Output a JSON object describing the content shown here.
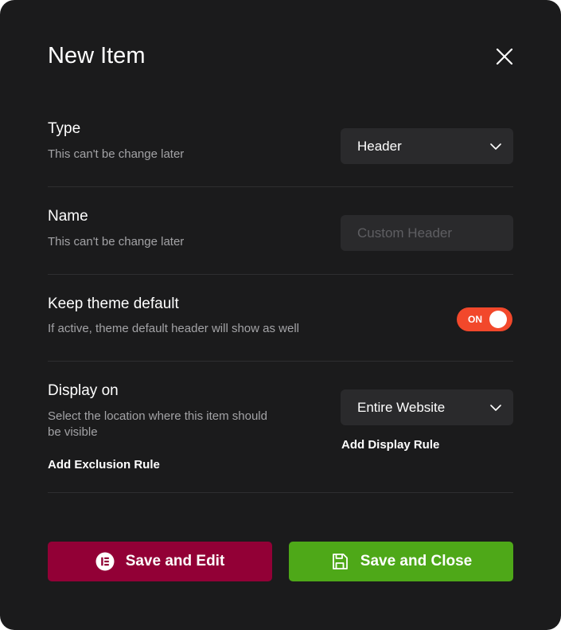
{
  "dialog": {
    "title": "New Item"
  },
  "fields": {
    "type": {
      "label": "Type",
      "description": "This can't be change later",
      "value": "Header"
    },
    "name": {
      "label": "Name",
      "description": "This can't be change later",
      "placeholder": "Custom Header",
      "value": ""
    },
    "keep_theme_default": {
      "label": "Keep theme default",
      "description": "If active, theme default header will show as well",
      "toggle_text": "ON",
      "enabled": true
    },
    "display_on": {
      "label": "Display on",
      "description_line1": "Select the location where this item should",
      "description_line2": "be visible",
      "value": "Entire Website",
      "add_display_rule": "Add Display Rule",
      "add_exclusion_rule": "Add Exclusion Rule"
    }
  },
  "actions": {
    "save_edit_label": "Save and Edit",
    "save_close_label": "Save and Close"
  },
  "icons": {
    "close": "close-icon",
    "chevron": "chevron-down-icon",
    "elementor": "elementor-icon",
    "save": "save-icon"
  },
  "colors": {
    "background": "#1b1b1c",
    "field": "#2a2a2c",
    "toggle_on": "#f2482b",
    "save_edit": "#920036",
    "save_close": "#4ea818"
  }
}
